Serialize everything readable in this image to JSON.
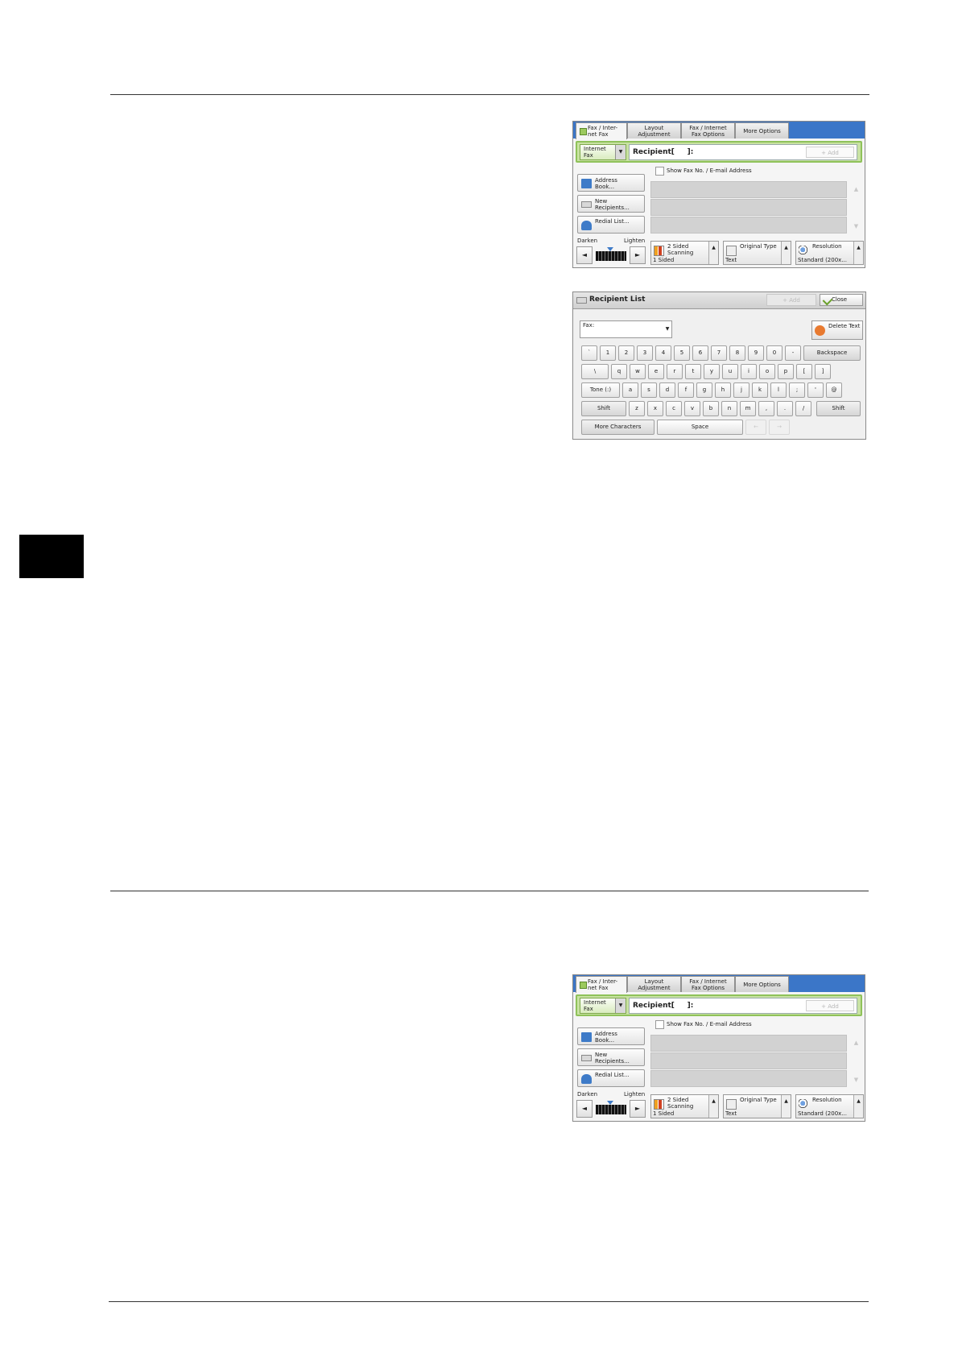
{
  "fax_screen": {
    "tabs": [
      "Fax / Inter-\nnet Fax",
      "Layout\nAdjustment",
      "Fax / Internet\nFax Options",
      "More Options"
    ],
    "mode_button": "Internet\nFax",
    "recipient_label": "Recipient[     ]:",
    "add_label": "+ Add",
    "show_checkbox_label": "Show Fax No. / E-mail Address",
    "buttons": {
      "address_book": "Address\nBook...",
      "new_recipients": "New\nRecipients...",
      "redial_list": "Redial List..."
    },
    "density": {
      "darken": "Darken",
      "lighten": "Lighten"
    },
    "features": [
      {
        "title": "2 Sided\nScanning",
        "value": "1 Sided",
        "icon": "two-sided-icon"
      },
      {
        "title": "Original Type",
        "value": "Text",
        "icon": "document-icon"
      },
      {
        "title": "Resolution",
        "value": "Standard (200x...",
        "icon": "magnifier-icon"
      }
    ]
  },
  "keyboard_screen": {
    "title": "Recipient List",
    "add_label": "+ Add",
    "close_label": "Close",
    "field_label": "Fax:",
    "delete_text": "Delete Text",
    "rows": [
      [
        "`",
        "1",
        "2",
        "3",
        "4",
        "5",
        "6",
        "7",
        "8",
        "9",
        "0",
        "-"
      ],
      [
        "\\",
        "q",
        "w",
        "e",
        "r",
        "t",
        "y",
        "u",
        "i",
        "o",
        "p",
        "[",
        "]"
      ],
      [
        "a",
        "s",
        "d",
        "f",
        "g",
        "h",
        "j",
        "k",
        "l",
        ";",
        "'",
        "@"
      ],
      [
        "z",
        "x",
        "c",
        "v",
        "b",
        "n",
        "m",
        ",",
        ".",
        "/"
      ]
    ],
    "special": {
      "backspace": "Backspace",
      "tone": "Tone (:)",
      "shift_left": "Shift",
      "shift_right": "Shift",
      "more_characters": "More Characters",
      "space": "Space",
      "left_arrow": "←",
      "right_arrow": "→"
    }
  }
}
